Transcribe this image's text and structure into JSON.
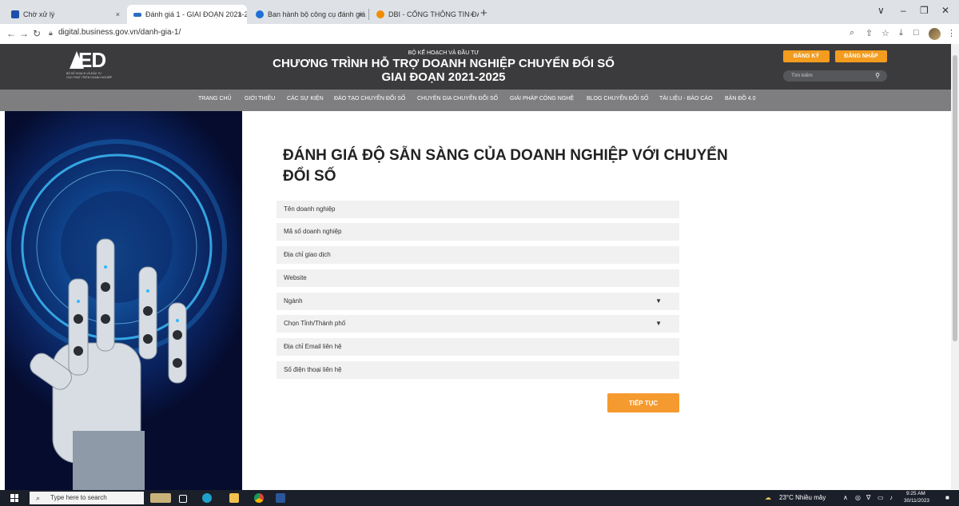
{
  "browser": {
    "tabs": [
      {
        "title": "Chờ xử lý",
        "fav_color": "#1f4fa8"
      },
      {
        "title": "Đánh giá 1 - GIAI ĐOẠN 2021-2",
        "fav_color": "#2b6fc4"
      },
      {
        "title": "Ban hành bộ công cụ đánh giá",
        "fav_color": "#1f6fd6"
      },
      {
        "title": "DBI - CỔNG THÔNG TIN ĐÁNH",
        "fav_color": "#f28c00"
      }
    ],
    "url": "digital.business.gov.vn/danh-gia-1/",
    "new_tab_glyph": "+",
    "close_glyph": "×"
  },
  "header": {
    "logo_text": "ED",
    "logo_sub1": "BỘ KẾ HOẠCH VÀ ĐẦU TƯ",
    "logo_sub2": "CỤC PHÁT TRIỂN DOANH NGHIỆP",
    "ministry": "BỘ KẾ HOẠCH VÀ ĐẦU TƯ",
    "program_line1": "CHƯƠNG TRÌNH HỖ TRỢ DOANH NGHIỆP CHUYỂN ĐỔI SỐ",
    "program_line2": "GIAI ĐOẠN 2021-2025",
    "register": "ĐĂNG KÝ",
    "login": "ĐĂNG NHẬP",
    "search_placeholder": "Tìm kiếm",
    "accent": "#f39c1f"
  },
  "nav": [
    "TRANG CHỦ",
    "GIỚI THIỆU",
    "CÁC SỰ KIỆN",
    "ĐÀO TẠO CHUYỂN ĐỔI SỐ",
    "CHUYÊN GIA CHUYỂN ĐỔI SỐ",
    "GIẢI PHÁP CÔNG NGHỆ",
    "BLOG CHUYỂN ĐỔI SỐ",
    "TÀI LIỆU - BÁO CÁO",
    "BẢN ĐỒ 4.0"
  ],
  "form": {
    "title_line1": "ĐÁNH GIÁ ĐỘ SẴN SÀNG CỦA DOANH NGHIỆP VỚI CHUYỂN",
    "title_line2": "ĐỔI SỐ",
    "fields": [
      {
        "placeholder": "Tên doanh nghiệp",
        "type": "text"
      },
      {
        "placeholder": "Mã số doanh nghiệp",
        "type": "text"
      },
      {
        "placeholder": "Địa chỉ giao dịch",
        "type": "text"
      },
      {
        "placeholder": "Website",
        "type": "text"
      },
      {
        "placeholder": "Ngành",
        "type": "select"
      },
      {
        "placeholder": "Chọn Tỉnh/Thành phố",
        "type": "select"
      },
      {
        "placeholder": "Địa chỉ Email liên hệ",
        "type": "text"
      },
      {
        "placeholder": "Số điện thoại liên hệ",
        "type": "text"
      }
    ],
    "submit": "TIẾP TỤC"
  },
  "taskbar": {
    "search_placeholder": "Type here to search",
    "weather": "23°C  Nhiều mây",
    "time": "9:25 AM",
    "date": "30/11/2023"
  }
}
